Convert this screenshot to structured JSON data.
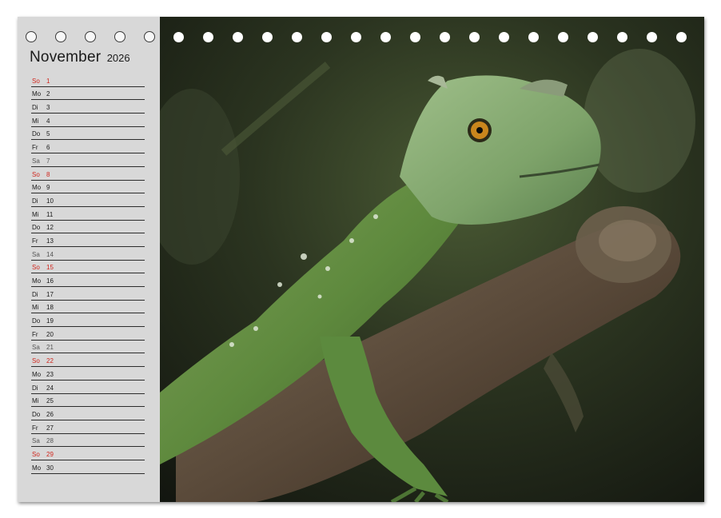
{
  "calendar": {
    "month": "November",
    "year": "2026",
    "days": [
      {
        "weekday": "So",
        "day": "1"
      },
      {
        "weekday": "Mo",
        "day": "2"
      },
      {
        "weekday": "Di",
        "day": "3"
      },
      {
        "weekday": "Mi",
        "day": "4"
      },
      {
        "weekday": "Do",
        "day": "5"
      },
      {
        "weekday": "Fr",
        "day": "6"
      },
      {
        "weekday": "Sa",
        "day": "7"
      },
      {
        "weekday": "So",
        "day": "8"
      },
      {
        "weekday": "Mo",
        "day": "9"
      },
      {
        "weekday": "Di",
        "day": "10"
      },
      {
        "weekday": "Mi",
        "day": "11"
      },
      {
        "weekday": "Do",
        "day": "12"
      },
      {
        "weekday": "Fr",
        "day": "13"
      },
      {
        "weekday": "Sa",
        "day": "14"
      },
      {
        "weekday": "So",
        "day": "15"
      },
      {
        "weekday": "Mo",
        "day": "16"
      },
      {
        "weekday": "Di",
        "day": "17"
      },
      {
        "weekday": "Mi",
        "day": "18"
      },
      {
        "weekday": "Do",
        "day": "19"
      },
      {
        "weekday": "Fr",
        "day": "20"
      },
      {
        "weekday": "Sa",
        "day": "21"
      },
      {
        "weekday": "So",
        "day": "22"
      },
      {
        "weekday": "Mo",
        "day": "23"
      },
      {
        "weekday": "Di",
        "day": "24"
      },
      {
        "weekday": "Mi",
        "day": "25"
      },
      {
        "weekday": "Do",
        "day": "26"
      },
      {
        "weekday": "Fr",
        "day": "27"
      },
      {
        "weekday": "Sa",
        "day": "28"
      },
      {
        "weekday": "So",
        "day": "29"
      },
      {
        "weekday": "Mo",
        "day": "30"
      }
    ]
  },
  "colors": {
    "sunday": "#d0261d",
    "panel": "#d8d8d8",
    "text": "#1a1a1a"
  },
  "photo": {
    "icon": "green-basilisk-lizard-on-branch"
  }
}
